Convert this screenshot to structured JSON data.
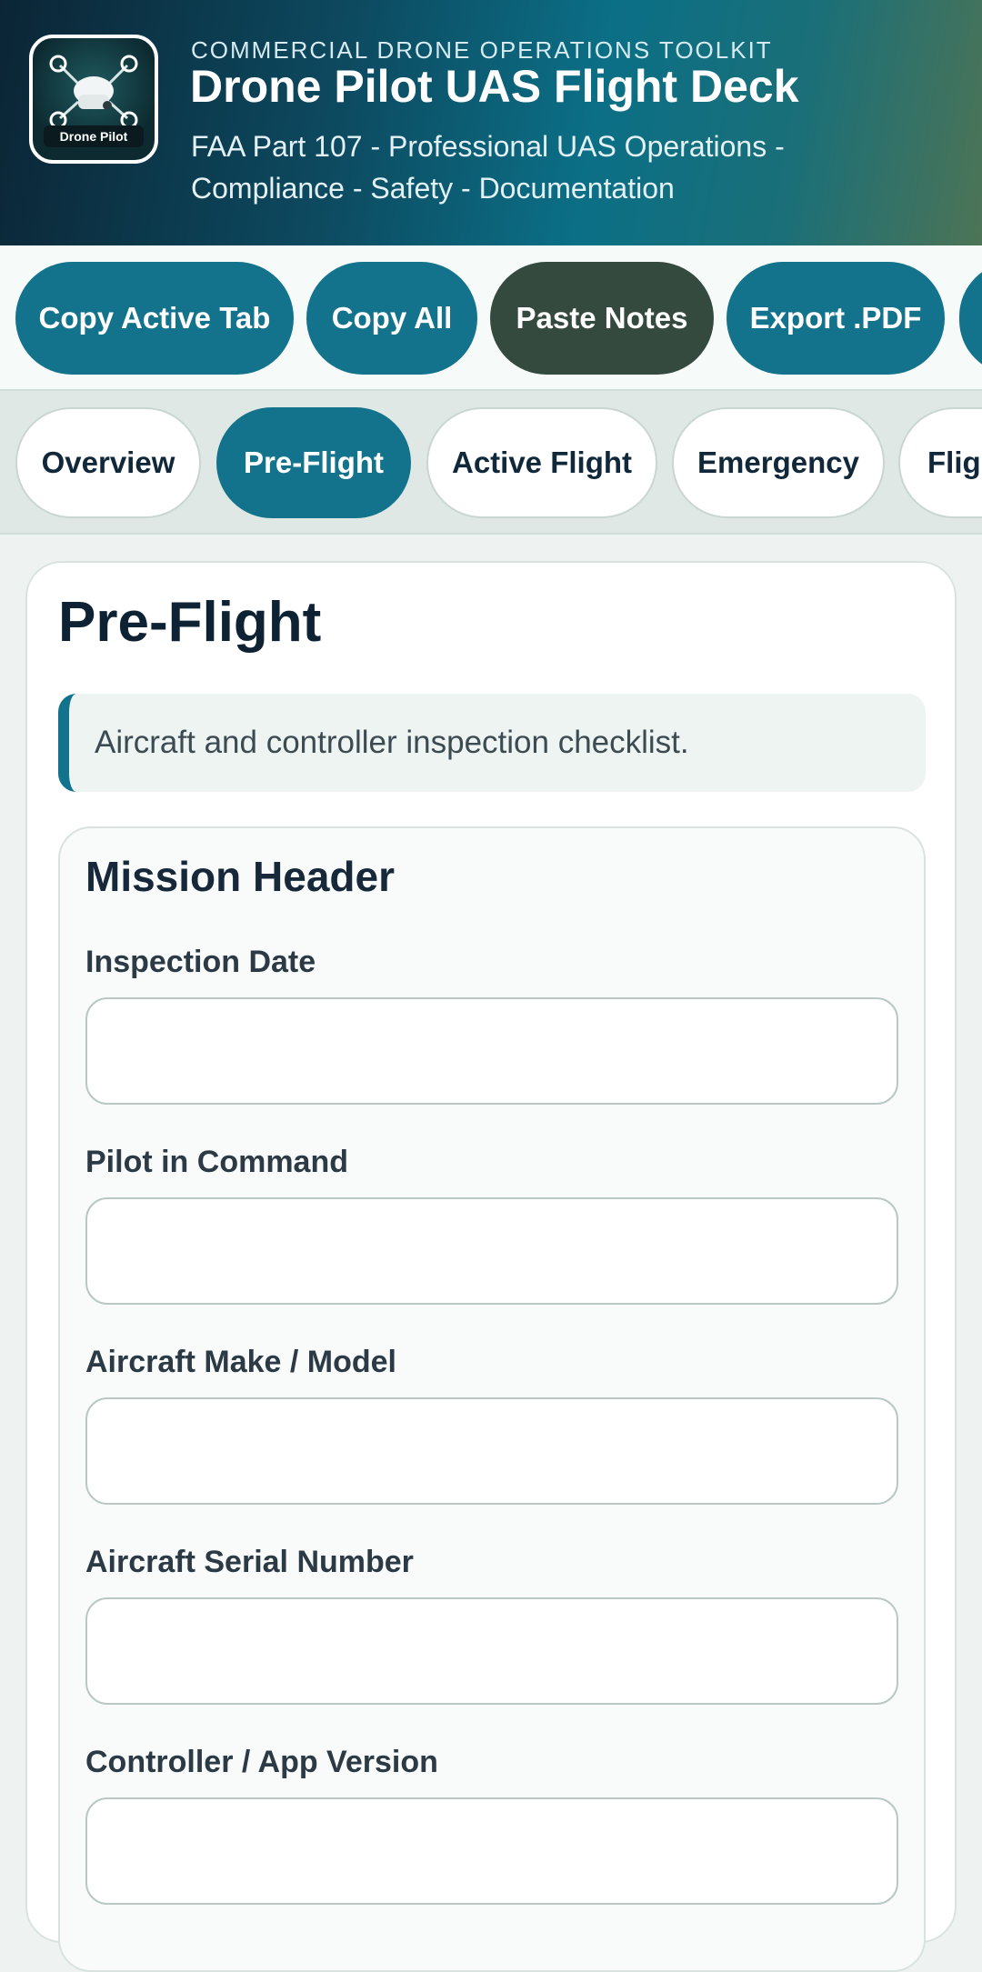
{
  "header": {
    "kicker": "COMMERCIAL DRONE OPERATIONS TOOLKIT",
    "title": "Drone Pilot UAS Flight Deck",
    "subtitle": "FAA Part 107 - Professional UAS Operations - Compliance - Safety - Documentation",
    "logo_text": "Drone Pilot"
  },
  "actions": [
    {
      "label": "Copy Active Tab"
    },
    {
      "label": "Copy All"
    },
    {
      "label": "Paste Notes"
    },
    {
      "label": "Export .PDF"
    }
  ],
  "tabs": [
    {
      "label": "Overview",
      "active": false
    },
    {
      "label": "Pre-Flight",
      "active": true
    },
    {
      "label": "Active Flight",
      "active": false
    },
    {
      "label": "Emergency",
      "active": false
    },
    {
      "label": "Fligh",
      "active": false
    }
  ],
  "page": {
    "title": "Pre-Flight",
    "note": "Aircraft and controller inspection checklist."
  },
  "section": {
    "title": "Mission Header",
    "fields": [
      {
        "label": "Inspection Date",
        "value": "",
        "placeholder": ""
      },
      {
        "label": "Pilot in Command",
        "value": "",
        "placeholder": ""
      },
      {
        "label": "Aircraft Make / Model",
        "value": "",
        "placeholder": ""
      },
      {
        "label": "Aircraft Serial Number",
        "value": "",
        "placeholder": ""
      },
      {
        "label": "Controller / App Version",
        "value": "",
        "placeholder": ""
      }
    ]
  },
  "colors": {
    "accent": "#13738c",
    "dark_button": "#354a3f",
    "header_dark": "#0b2535"
  }
}
